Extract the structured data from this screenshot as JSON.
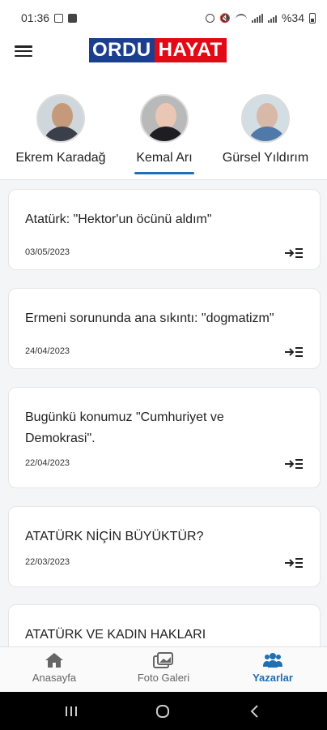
{
  "status_bar": {
    "time": "01:36",
    "battery": "%34"
  },
  "header": {
    "logo_part1": "ORDU",
    "logo_part2": "HAYAT"
  },
  "authors": [
    {
      "name": "Ekrem Karadağ",
      "active": false
    },
    {
      "name": "Kemal Arı",
      "active": true
    },
    {
      "name": "Gürsel Yıldırım",
      "active": false
    }
  ],
  "articles": [
    {
      "title": "Atatürk: \"Hektor'un öcünü aldım\"",
      "date": "03/05/2023"
    },
    {
      "title": "Ermeni sorununda ana sıkıntı: \"dogmatizm\"",
      "date": "24/04/2023"
    },
    {
      "title": "Bugünkü konumuz \"Cumhuriyet ve Demokrasi\".",
      "date": "22/04/2023"
    },
    {
      "title": "ATATÜRK NİÇİN BÜYÜKTÜR?",
      "date": "22/03/2023"
    },
    {
      "title": "ATATÜRK VE KADIN HAKLARI",
      "date": ""
    }
  ],
  "bottom_nav": [
    {
      "label": "Anasayfa",
      "icon": "home-icon",
      "active": false
    },
    {
      "label": "Foto Galeri",
      "icon": "gallery-icon",
      "active": false
    },
    {
      "label": "Yazarlar",
      "icon": "people-icon",
      "active": true
    }
  ],
  "colors": {
    "accent": "#1f6fb5",
    "logo_blue": "#1c3e8f",
    "logo_red": "#e30a17"
  }
}
